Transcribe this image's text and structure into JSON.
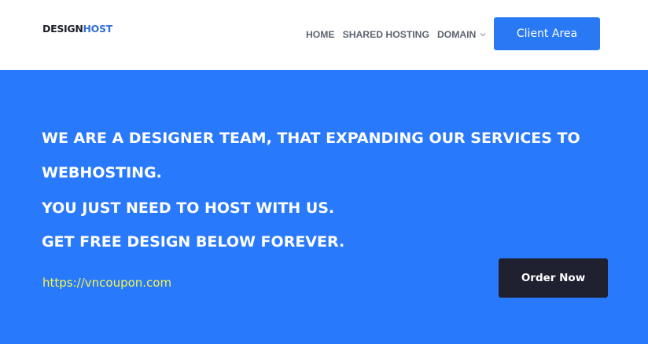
{
  "header": {
    "logo_part1": "DESIGN",
    "logo_part2": "HOST",
    "nav": {
      "home": "HOME",
      "shared_hosting": "SHARED HOSTING",
      "domain": "DOMAIN",
      "domain_icon": "chevron-down-icon"
    },
    "client_area_label": "Client Area"
  },
  "hero": {
    "line1": "WE ARE A DESIGNER TEAM, THAT EXPANDING OUR SERVICES TO",
    "line2": "WEBHOSTING.",
    "line3": "YOU JUST NEED TO HOST WITH US.",
    "line4": "GET FREE DESIGN BELOW FOREVER.",
    "url": "https://vncoupon.com",
    "order_label": "Order Now"
  },
  "colors": {
    "hero_background": "#2979fd",
    "accent_blue": "#2979f5",
    "order_button": "#1f2130",
    "url_yellow": "#f4f54b"
  }
}
